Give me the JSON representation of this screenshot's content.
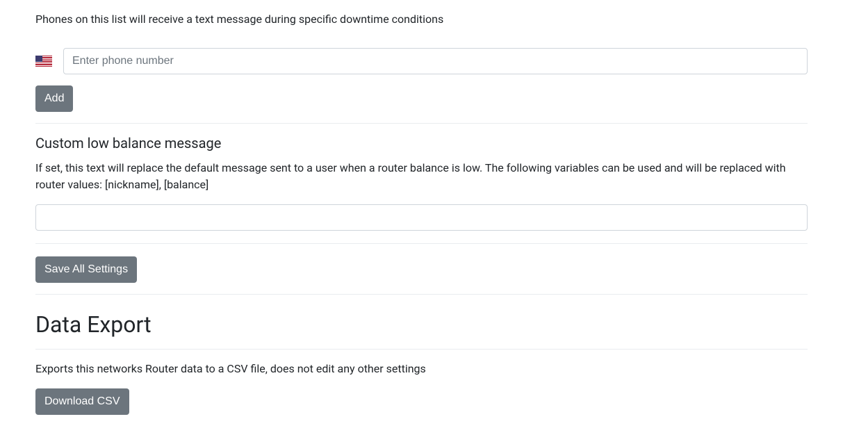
{
  "phoneList": {
    "description": "Phones on this list will receive a text message during specific downtime conditions",
    "placeholder": "Enter phone number",
    "addLabel": "Add",
    "flagCountry": "us"
  },
  "customMessage": {
    "heading": "Custom low balance message",
    "help": "If set, this text will replace the default message sent to a user when a router balance is low. The following variables can be used and will be replaced with router values: [nickname], [balance]",
    "value": ""
  },
  "saveAllLabel": "Save All Settings",
  "dataExport": {
    "heading": "Data Export",
    "help": "Exports this networks Router data to a CSV file, does not edit any other settings",
    "downloadLabel": "Download CSV"
  }
}
